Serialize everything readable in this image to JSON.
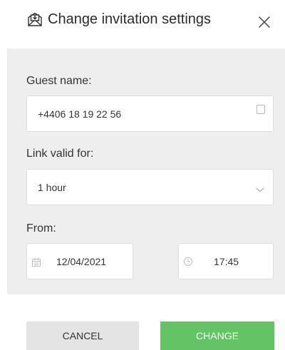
{
  "dialog": {
    "title": "Change invitation settings",
    "title_icon": "invitation-envelope-icon",
    "close_icon": "close-icon"
  },
  "form": {
    "guest_name": {
      "label": "Guest name:",
      "value": "+4406 18 19 22 56",
      "icon": "contact-card-icon"
    },
    "link_valid_for": {
      "label": "Link valid for:",
      "selected": "1 hour",
      "icon": "chevron-down-icon"
    },
    "from": {
      "label": "From:",
      "date": "12/04/2021",
      "date_icon": "calendar-icon",
      "time": "17:45",
      "time_icon": "clock-icon"
    }
  },
  "actions": {
    "cancel_label": "CANCEL",
    "change_label": "CHANGE"
  },
  "colors": {
    "panel_background": "#eeeeee",
    "change_button": "#62c462",
    "cancel_button": "#e4e4e4"
  }
}
